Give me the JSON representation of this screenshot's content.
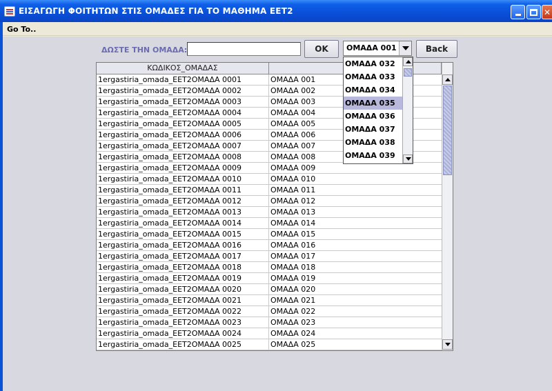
{
  "window": {
    "title": "ΕΙΣΑΓΩΓΗ ΦΟΙΤΗΤΩΝ ΣΤΙΣ ΟΜΑΔΕΣ ΓΙΑ ΤΟ ΜΑΘΗΜΑ ΕΕΤ2"
  },
  "menu": {
    "goto": "Go To.."
  },
  "form": {
    "label": "ΔΩΣΤΕ ΤΗΝ ΟΜΑΔΑ:",
    "input_value": "",
    "ok_label": "OK",
    "back_label": "Back",
    "combo_value": "ΟΜΑΔΑ 001"
  },
  "dropdown": {
    "options": [
      "ΟΜΑΔΑ 032",
      "ΟΜΑΔΑ 033",
      "ΟΜΑΔΑ 034",
      "ΟΜΑΔΑ 035",
      "ΟΜΑΔΑ 036",
      "ΟΜΑΔΑ 037",
      "ΟΜΑΔΑ 038",
      "ΟΜΑΔΑ 039"
    ],
    "selected_index": 3
  },
  "table": {
    "headers": [
      "ΚΩΔΙΚΟΣ_ΟΜΑΔΑΣ",
      ""
    ],
    "rows": [
      [
        "1ergastiria_omada_EET2ΟΜΑΔΑ 0001",
        "ΟΜΑΔΑ 001"
      ],
      [
        "1ergastiria_omada_EET2ΟΜΑΔΑ 0002",
        "ΟΜΑΔΑ 002"
      ],
      [
        "1ergastiria_omada_EET2ΟΜΑΔΑ 0003",
        "ΟΜΑΔΑ 003"
      ],
      [
        "1ergastiria_omada_EET2ΟΜΑΔΑ 0004",
        "ΟΜΑΔΑ 004"
      ],
      [
        "1ergastiria_omada_EET2ΟΜΑΔΑ 0005",
        "ΟΜΑΔΑ 005"
      ],
      [
        "1ergastiria_omada_EET2ΟΜΑΔΑ 0006",
        "ΟΜΑΔΑ 006"
      ],
      [
        "1ergastiria_omada_EET2ΟΜΑΔΑ 0007",
        "ΟΜΑΔΑ 007"
      ],
      [
        "1ergastiria_omada_EET2ΟΜΑΔΑ 0008",
        "ΟΜΑΔΑ 008"
      ],
      [
        "1ergastiria_omada_EET2ΟΜΑΔΑ 0009",
        "ΟΜΑΔΑ 009"
      ],
      [
        "1ergastiria_omada_EET2ΟΜΑΔΑ 0010",
        "ΟΜΑΔΑ 010"
      ],
      [
        "1ergastiria_omada_EET2ΟΜΑΔΑ 0011",
        "ΟΜΑΔΑ 011"
      ],
      [
        "1ergastiria_omada_EET2ΟΜΑΔΑ 0012",
        "ΟΜΑΔΑ 012"
      ],
      [
        "1ergastiria_omada_EET2ΟΜΑΔΑ 0013",
        "ΟΜΑΔΑ 013"
      ],
      [
        "1ergastiria_omada_EET2ΟΜΑΔΑ 0014",
        "ΟΜΑΔΑ 014"
      ],
      [
        "1ergastiria_omada_EET2ΟΜΑΔΑ 0015",
        "ΟΜΑΔΑ 015"
      ],
      [
        "1ergastiria_omada_EET2ΟΜΑΔΑ 0016",
        "ΟΜΑΔΑ 016"
      ],
      [
        "1ergastiria_omada_EET2ΟΜΑΔΑ 0017",
        "ΟΜΑΔΑ 017"
      ],
      [
        "1ergastiria_omada_EET2ΟΜΑΔΑ 0018",
        "ΟΜΑΔΑ 018"
      ],
      [
        "1ergastiria_omada_EET2ΟΜΑΔΑ 0019",
        "ΟΜΑΔΑ 019"
      ],
      [
        "1ergastiria_omada_EET2ΟΜΑΔΑ 0020",
        "ΟΜΑΔΑ 020"
      ],
      [
        "1ergastiria_omada_EET2ΟΜΑΔΑ 0021",
        "ΟΜΑΔΑ 021"
      ],
      [
        "1ergastiria_omada_EET2ΟΜΑΔΑ 0022",
        "ΟΜΑΔΑ 022"
      ],
      [
        "1ergastiria_omada_EET2ΟΜΑΔΑ 0023",
        "ΟΜΑΔΑ 023"
      ],
      [
        "1ergastiria_omada_EET2ΟΜΑΔΑ 0024",
        "ΟΜΑΔΑ 024"
      ],
      [
        "1ergastiria_omada_EET2ΟΜΑΔΑ 0025",
        "ΟΜΑΔΑ 025"
      ]
    ]
  },
  "icons": {
    "app": "app-window-icon",
    "minimize": "minimize-icon",
    "maximize": "maximize-icon",
    "close": "close-icon"
  }
}
